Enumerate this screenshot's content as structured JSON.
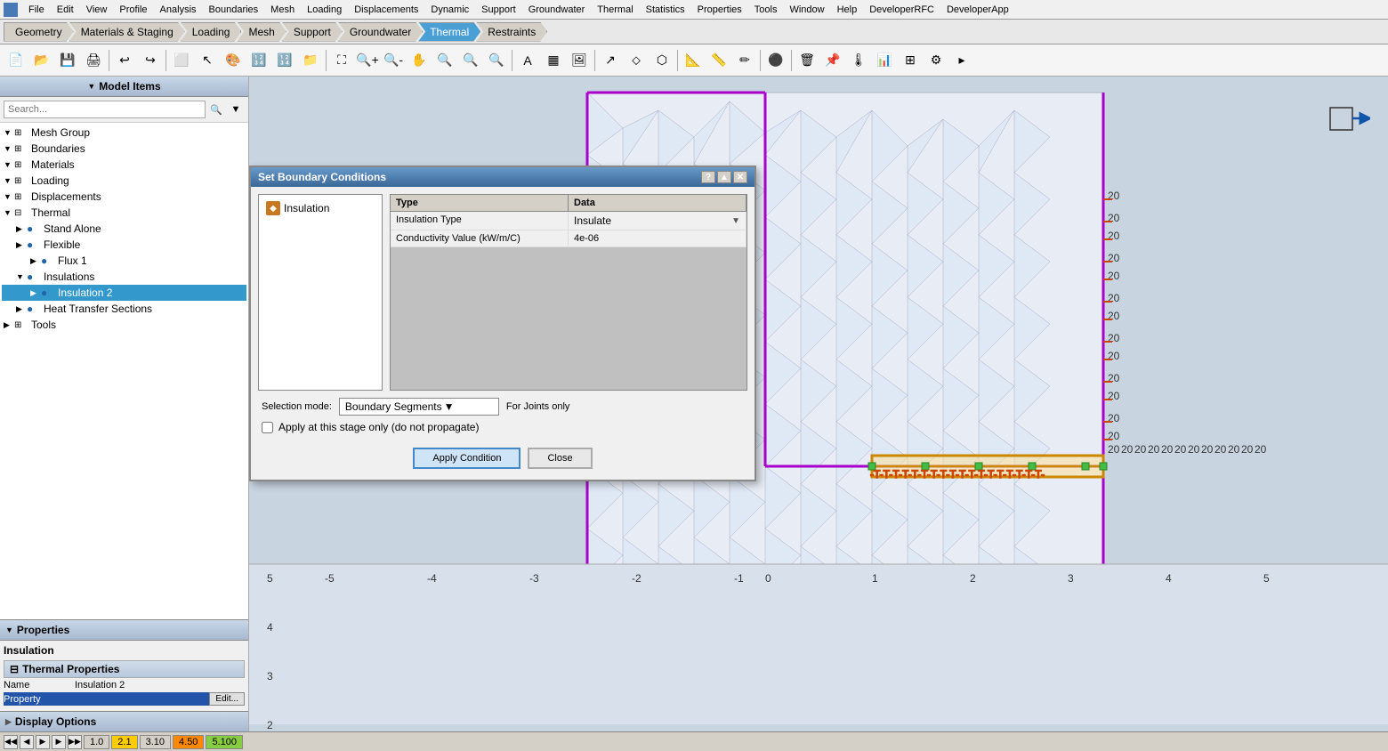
{
  "menubar": {
    "items": [
      "File",
      "Edit",
      "View",
      "Profile",
      "Analysis",
      "Boundaries",
      "Mesh",
      "Loading",
      "Displacements",
      "Dynamic",
      "Support",
      "Groundwater",
      "Thermal",
      "Statistics",
      "Properties",
      "Tools",
      "Window",
      "Help",
      "DeveloperRFC",
      "DeveloperApp"
    ]
  },
  "workflow": {
    "tabs": [
      {
        "label": "Geometry",
        "active": false
      },
      {
        "label": "Materials & Staging",
        "active": false
      },
      {
        "label": "Loading",
        "active": false
      },
      {
        "label": "Mesh",
        "active": false
      },
      {
        "label": "Support",
        "active": false
      },
      {
        "label": "Groundwater",
        "active": false
      },
      {
        "label": "Thermal",
        "active": true
      },
      {
        "label": "Restraints",
        "active": false
      }
    ]
  },
  "left_panel": {
    "model_items_header": "Model Items",
    "search_placeholder": "Search...",
    "tree": [
      {
        "label": "Mesh Group",
        "indent": 0,
        "expand": true,
        "icon": "⊞",
        "node_icon": "🔲"
      },
      {
        "label": "Boundaries",
        "indent": 0,
        "expand": true,
        "icon": "⊞",
        "node_icon": "📐"
      },
      {
        "label": "Materials",
        "indent": 0,
        "expand": true,
        "icon": "⊞",
        "node_icon": "🎨"
      },
      {
        "label": "Loading",
        "indent": 0,
        "expand": true,
        "icon": "⊞",
        "node_icon": "⬇"
      },
      {
        "label": "Displacements",
        "indent": 0,
        "expand": true,
        "icon": "⊞",
        "node_icon": "↔"
      },
      {
        "label": "Thermal",
        "indent": 0,
        "expand": true,
        "icon": "⊟",
        "node_icon": "🌡"
      },
      {
        "label": "Stand Alone",
        "indent": 1,
        "expand": false,
        "icon": "",
        "node_icon": "👁"
      },
      {
        "label": "Flexible",
        "indent": 1,
        "expand": false,
        "icon": "",
        "node_icon": "👁"
      },
      {
        "label": "Flux 1",
        "indent": 2,
        "expand": false,
        "icon": "",
        "node_icon": "👁"
      },
      {
        "label": "Insulations",
        "indent": 1,
        "expand": true,
        "icon": "⊟",
        "node_icon": "👁"
      },
      {
        "label": "Insulation 2",
        "indent": 2,
        "expand": false,
        "icon": "",
        "node_icon": "👁",
        "selected": true
      },
      {
        "label": "Heat Transfer Sections",
        "indent": 1,
        "expand": false,
        "icon": "",
        "node_icon": "👁"
      },
      {
        "label": "Tools",
        "indent": 0,
        "expand": false,
        "icon": "⊞",
        "node_icon": "🔧"
      }
    ],
    "properties_header": "Properties",
    "properties_title": "Insulation",
    "thermal_props_header": "Thermal Properties",
    "prop_name_label": "Name",
    "prop_name_value": "Insulation 2",
    "prop_property_label": "Property",
    "prop_edit_btn": "Edit...",
    "display_options_header": "Display Options"
  },
  "dialog": {
    "title": "Set Boundary Conditions",
    "insulation_item": "Insulation",
    "col_type": "Type",
    "col_data": "Data",
    "row1_type": "Insulation Type",
    "row1_data": "Insulate",
    "row2_type": "Conductivity Value (kW/m/C)",
    "row2_data": "4e-06",
    "selection_mode_label": "Selection mode:",
    "selection_mode_value": "Boundary Segments",
    "for_joints_label": "For Joints only",
    "apply_checkbox_label": "Apply at this stage only (do not propagate)",
    "apply_btn": "Apply Condition",
    "close_btn": "Close"
  },
  "status_bar": {
    "nav_first": "◀◀",
    "nav_prev": "◀",
    "nav_play": "▶",
    "nav_next": "▶",
    "nav_last": "▶▶",
    "stage1": "1.0",
    "stage2": "2.1",
    "stage3": "3.10",
    "stage4": "4.50",
    "stage5": "5.100"
  },
  "toolbar": {
    "buttons": [
      "📁",
      "💾",
      "↩",
      "↪",
      "📋",
      "🔲",
      "🎨",
      "🔢",
      "💰",
      "📂",
      "⛶",
      "🔍",
      "🔎",
      "✋",
      "🔍",
      "🔍",
      "🔍",
      "🔍",
      "✏",
      "📊",
      "📷",
      "↗",
      "⬦",
      "⬡",
      "📐",
      "🔺",
      "↔",
      "✏",
      "⬤",
      "🗑",
      "📌",
      "🌡",
      "📊",
      "⊞",
      "🔧"
    ]
  }
}
